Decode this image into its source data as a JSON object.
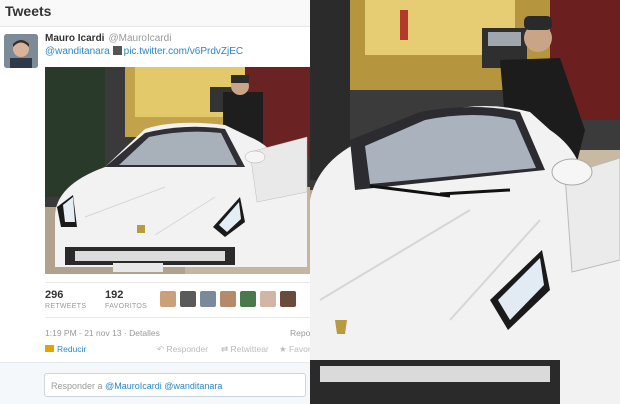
{
  "header": {
    "title": "Tweets"
  },
  "tweet": {
    "author_name": "Mauro Icardi",
    "author_handle": "@MauroIcardi",
    "mention": "@wanditanara",
    "link": "pic.twitter.com/v6PrdvZjEC",
    "stats": {
      "retweets_count": "296",
      "retweets_label": "RETWEETS",
      "favorites_count": "192",
      "favorites_label": "FAVORITOS"
    },
    "timestamp": "1:19 PM - 21 nov 13",
    "details_label": "Detalles",
    "right_meta": "Repo",
    "actions": {
      "reduce": "Reducir",
      "reply": "Responder",
      "retweet": "Retwittear",
      "favorite": "Favori"
    },
    "reply_prompt": "Responder a",
    "reply_mentions": "@MauroIcardi @wanditanara"
  },
  "colors": {
    "link_blue": "#2a87c8",
    "car_white": "#f2f2f2",
    "action_gold": "#e3a400"
  }
}
